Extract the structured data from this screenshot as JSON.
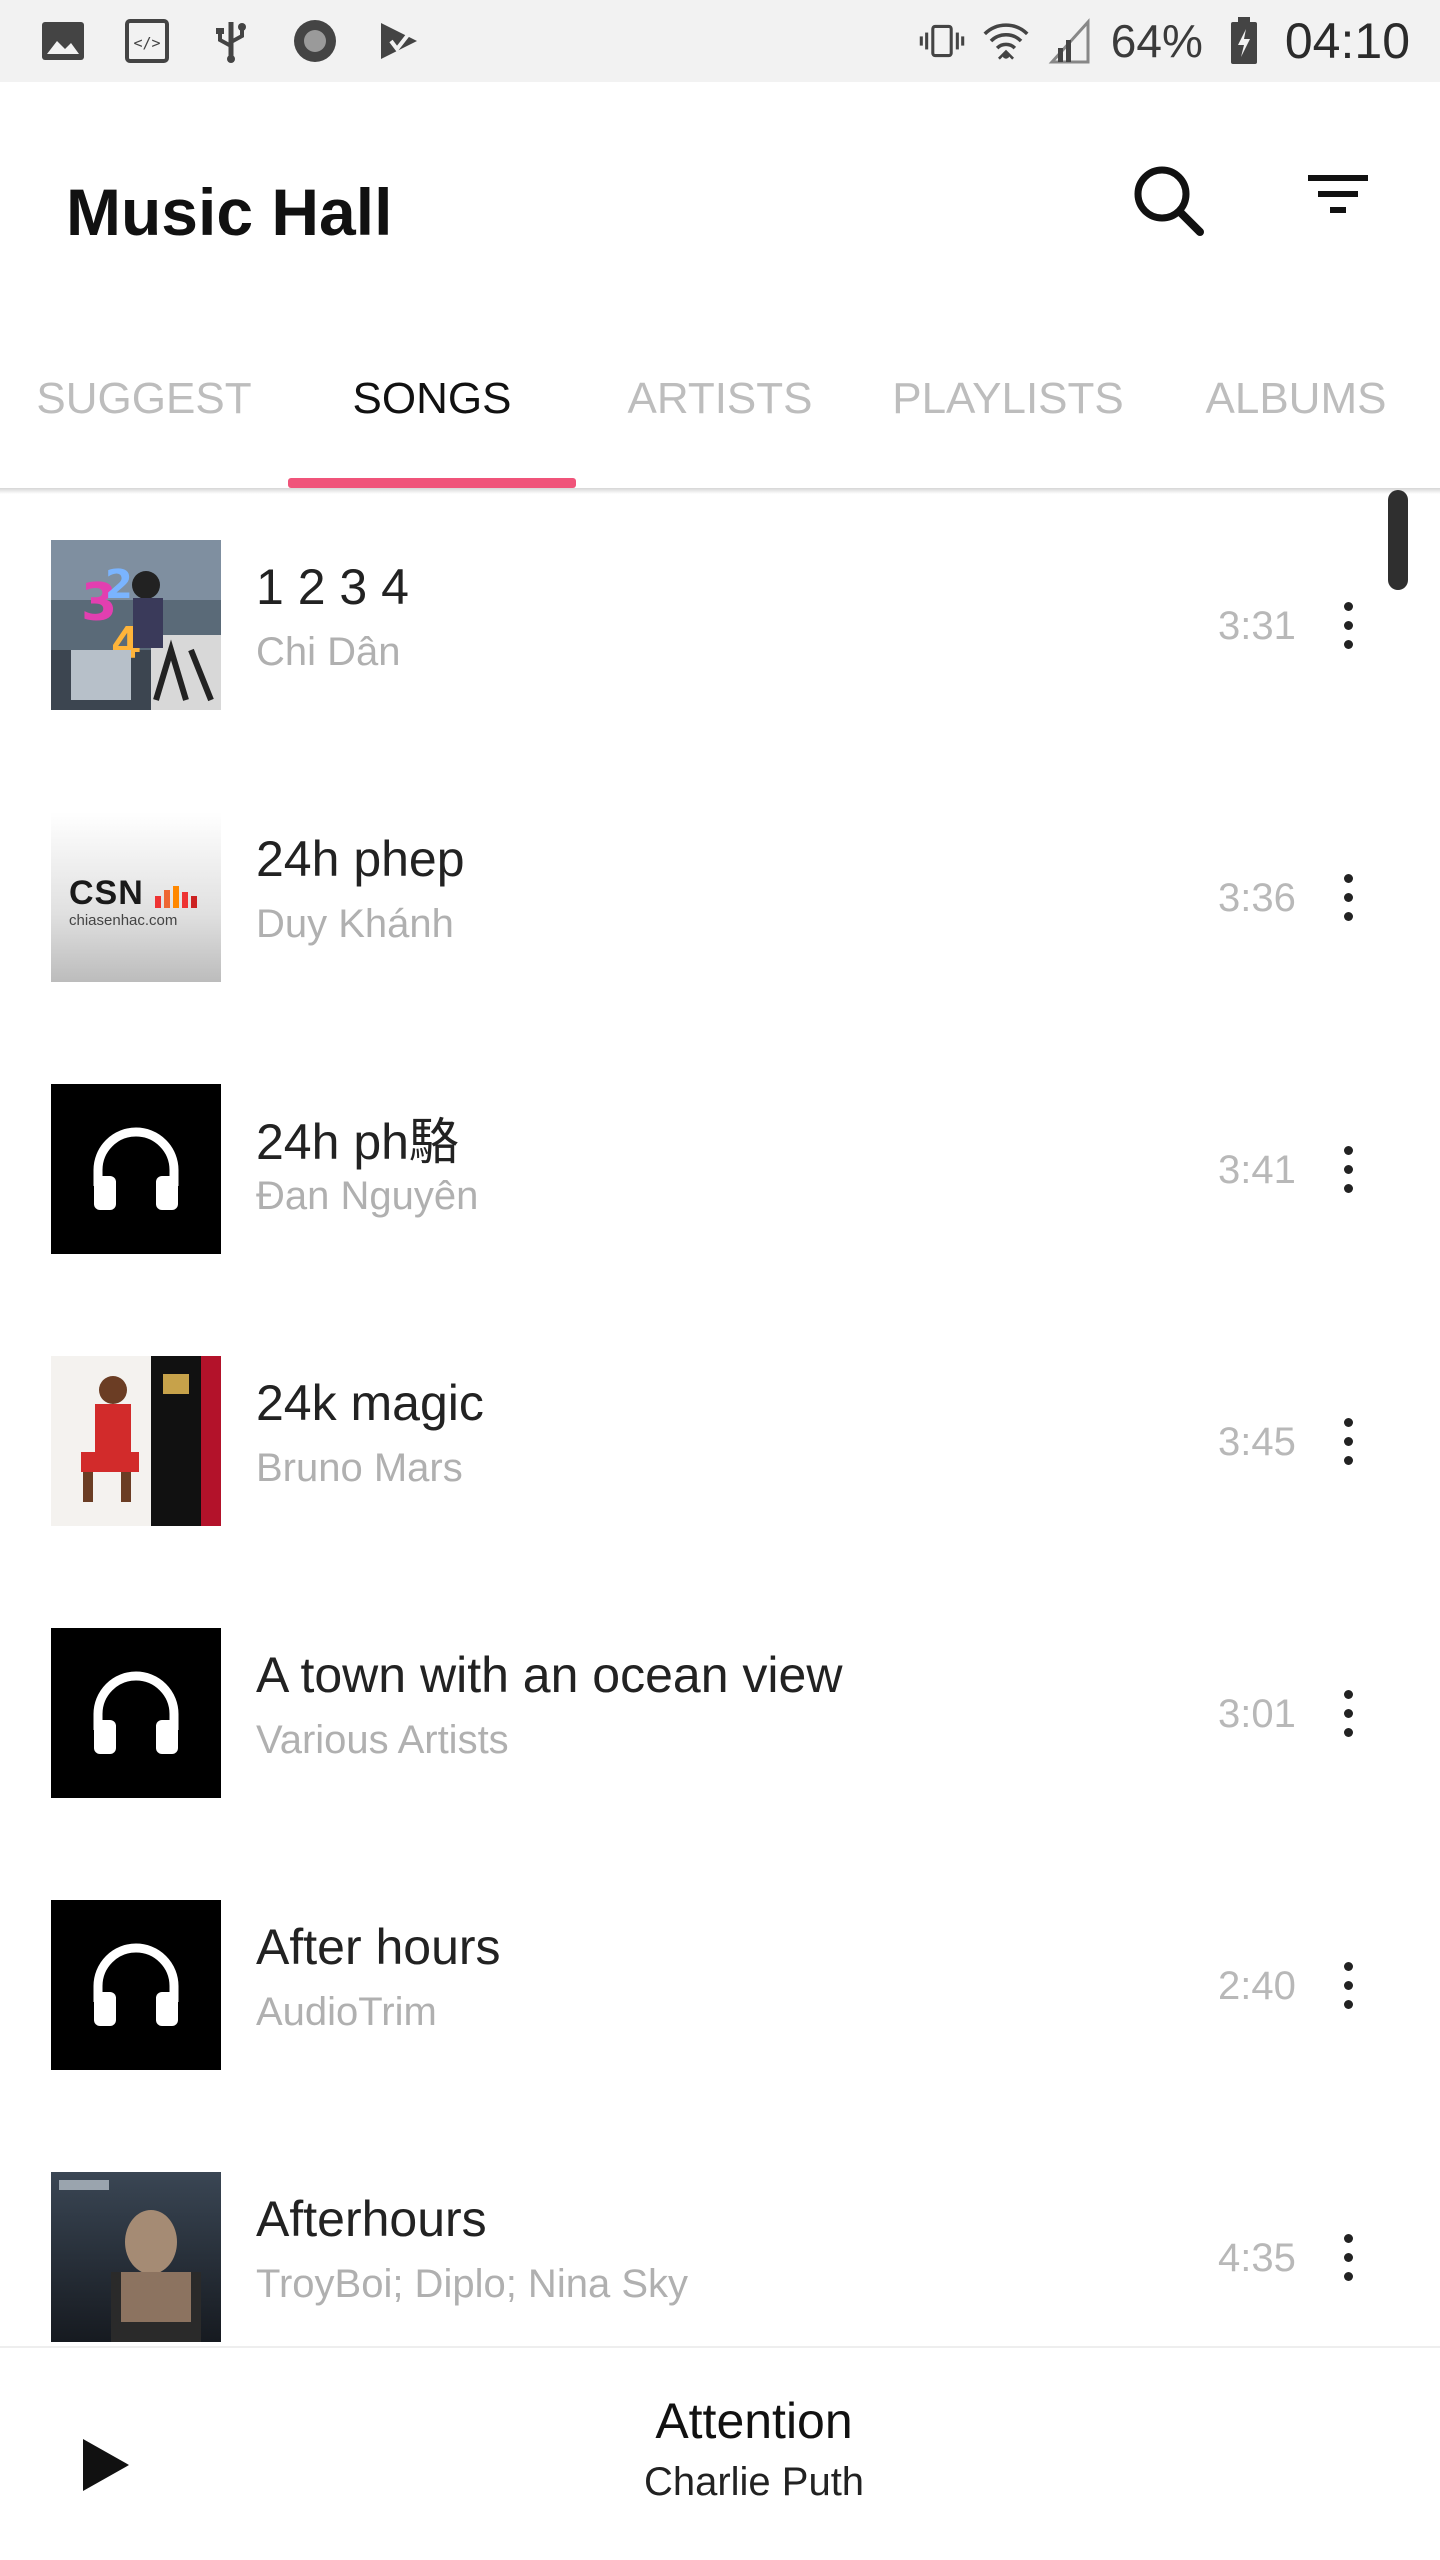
{
  "status_bar": {
    "left_icons": [
      "image-icon",
      "code-icon",
      "usb-icon",
      "circle-icon",
      "play-store-icon"
    ],
    "battery_percent": "64%",
    "time": "04:10"
  },
  "app": {
    "title": "Music Hall"
  },
  "tabs": [
    {
      "label": "SUGGEST",
      "active": false
    },
    {
      "label": "SONGS",
      "active": true
    },
    {
      "label": "ARTISTS",
      "active": false
    },
    {
      "label": "PLAYLISTS",
      "active": false
    },
    {
      "label": "ALBUMS",
      "active": false
    }
  ],
  "songs": [
    {
      "title": "1 2 3 4",
      "artist": "Chi Dân",
      "duration": "3:31",
      "cover": "album-art-1234"
    },
    {
      "title": "24h phep",
      "artist": "Duy Khánh",
      "duration": "3:36",
      "cover": "csn-logo",
      "cover_text": "CSN",
      "cover_subtext": "chiasenhac.com"
    },
    {
      "title": "24h ph駱",
      "artist": "Đan Nguyên",
      "duration": "3:41",
      "cover": "headphones-icon"
    },
    {
      "title": "24k magic",
      "artist": "Bruno Mars",
      "duration": "3:45",
      "cover": "album-art-24k-magic"
    },
    {
      "title": "A town with an ocean view",
      "artist": "Various Artists",
      "duration": "3:01",
      "cover": "headphones-icon"
    },
    {
      "title": "After hours",
      "artist": "AudioTrim",
      "duration": "2:40",
      "cover": "headphones-icon"
    },
    {
      "title": "Afterhours",
      "artist": "TroyBoi; Diplo; Nina Sky",
      "duration": "4:35",
      "cover": "album-art-afterhours"
    }
  ],
  "now_playing": {
    "title": "Attention",
    "artist": "Charlie Puth"
  },
  "colors": {
    "accent": "#f0547a",
    "secondary_text": "#b0b0b0"
  }
}
